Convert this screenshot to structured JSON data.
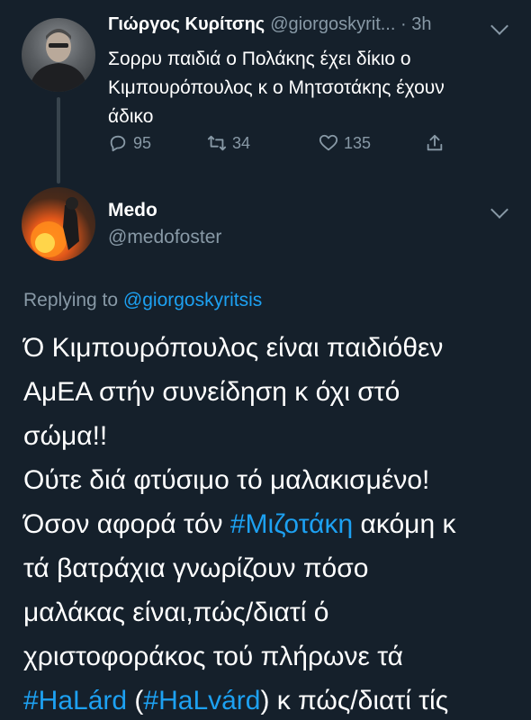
{
  "tweet1": {
    "display_name": "Γιώργος Κυρίτσης",
    "handle_meta": "@giorgoskyrit... · 3h",
    "text": "Σορρυ παιδιά ο Πολάκης έχει δίκιο ο Κιμπουρόπουλος κ ο Μητσοτάκης έχουν άδικο",
    "actions": {
      "reply_count": "95",
      "retweet_count": "34",
      "like_count": "135"
    }
  },
  "tweet2": {
    "display_name": "Medo",
    "handle": "@medofoster",
    "replying_label": "Replying to",
    "replying_handle": "@giorgoskyritsis",
    "body": {
      "line1": "Ό Κιμπουρόπουλος είναι παιδιόθεν",
      "line2": "ΑμΕΑ στήν συνείδηση κ όχι στό",
      "line3": "σώμα!!",
      "line4": "Ούτε διά φτύσιμο τό μαλακισμένο!",
      "line5_pre": "Όσον αφορά τόν ",
      "hashtag1": "#Μιζοτάκη",
      "line5_post": " ακόμη κ",
      "line6": "τά βατράχια γνωρίζουν πόσο",
      "line7": "μαλάκας είναι,πώς/διατί ό",
      "line8": "χριστοφοράκος τού πλήρωνε τά",
      "hashtag2": "#HaLárd",
      "paren_open": " (",
      "hashtag3": "#HaLvárd",
      "line9_post": ") κ πώς/διατί τίς"
    }
  },
  "colors": {
    "background": "#15202b",
    "text": "#ffffff",
    "muted": "#8899a6",
    "link": "#1da1f2"
  },
  "icons": [
    "reply-icon",
    "retweet-icon",
    "like-icon",
    "share-icon",
    "chevron-down-icon"
  ]
}
